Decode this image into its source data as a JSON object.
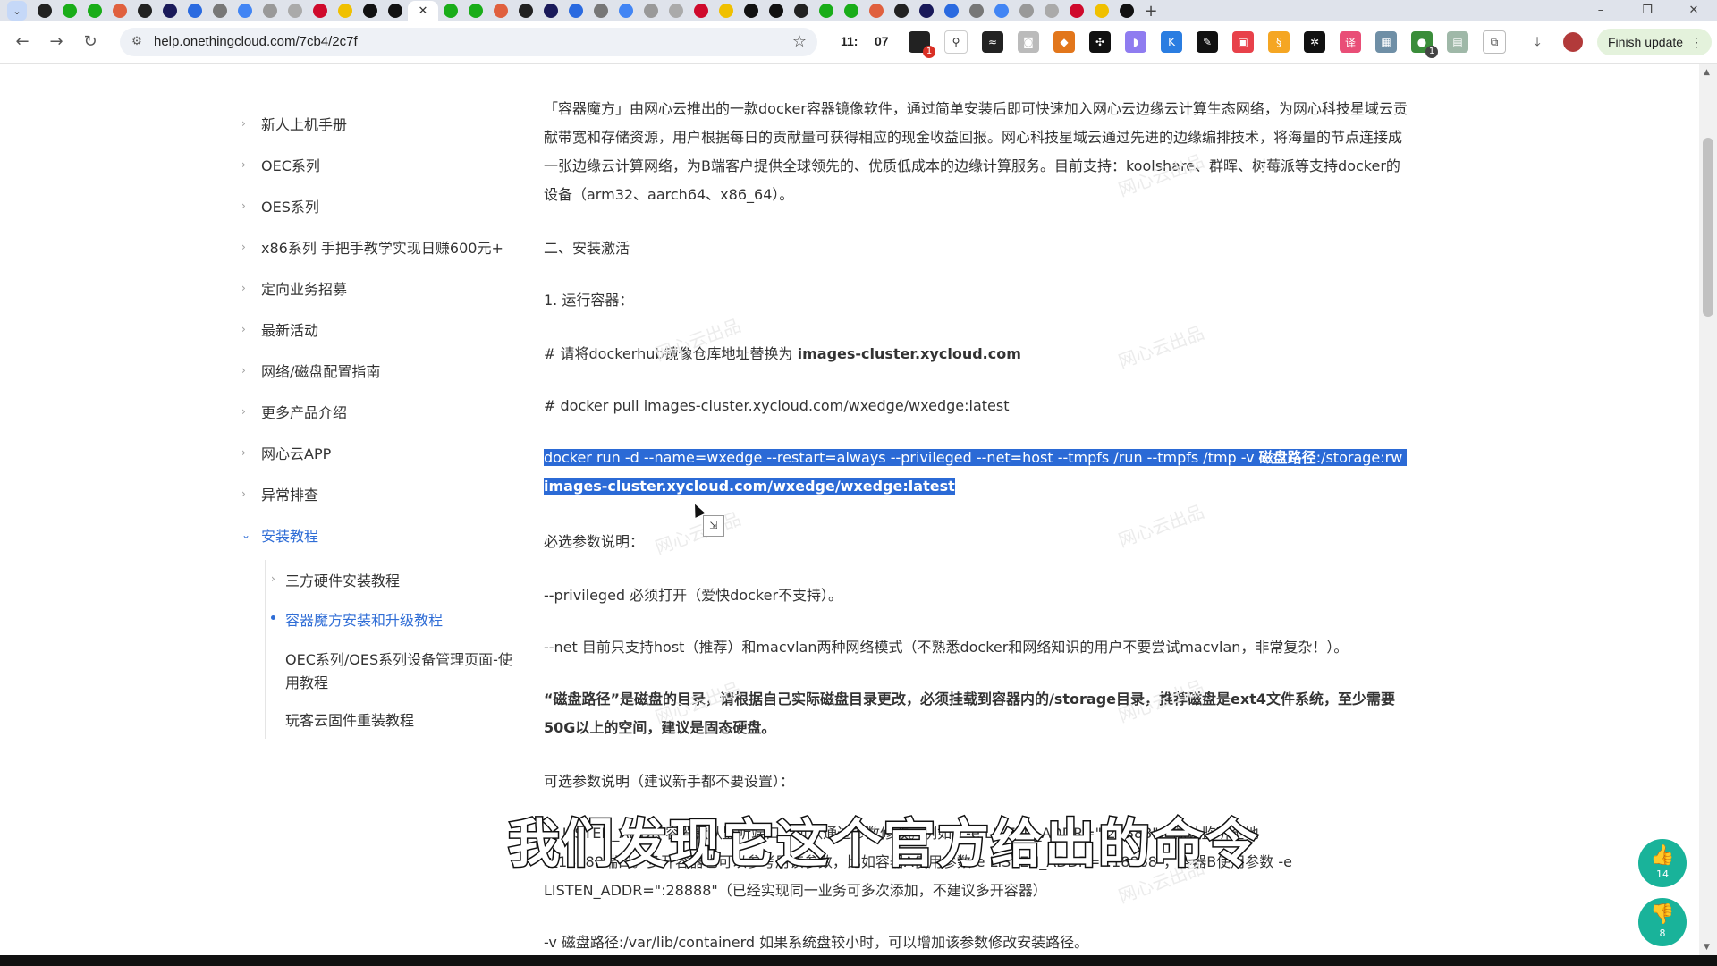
{
  "browser": {
    "tabs_count_visible": 44,
    "url": "help.onethingcloud.com/7cb4/2c7f",
    "clock_hour": "11:",
    "clock_min": "07",
    "ext_badge_1": "1",
    "ext_badge_2": "1",
    "finish_update": "Finish update",
    "new_tab": "+",
    "win_min": "–",
    "win_restore": "❐",
    "win_close": "✕"
  },
  "sidebar": {
    "items": [
      {
        "label": "新人上机手册"
      },
      {
        "label": "OEC系列"
      },
      {
        "label": "OES系列"
      },
      {
        "label": "x86系列 手把手教学实现日赚600元+"
      },
      {
        "label": "定向业务招募"
      },
      {
        "label": "最新活动"
      },
      {
        "label": "网络/磁盘配置指南"
      },
      {
        "label": "更多产品介绍"
      },
      {
        "label": "网心云APP"
      },
      {
        "label": "异常排查"
      },
      {
        "label": "安装教程"
      }
    ],
    "sub_items": [
      {
        "label": "三方硬件安装教程"
      },
      {
        "label": "容器魔方安装和升级教程"
      },
      {
        "label": "OEC系列/OES系列设备管理页面-使"
      },
      {
        "label": "用教程"
      },
      {
        "label": "玩客云固件重装教程"
      }
    ]
  },
  "content": {
    "intro_1": "「容器魔方」由网心云推出的一款docker容器镜像软件，通过简单安装后即可快速加入网心云边缘云计算生态网络，为网心科技星域云贡",
    "intro_2": "献带宽和存储资源，用户根据每日的贡献量可获得相应的现金收益回报。网心科技星域云通过先进的边缘编排技术，将海量的节点连接成",
    "intro_3": "一张边缘云计算网络，为B端客户提供全球领先的、优质低成本的边缘计算服务。目前支持：koolshare、群晖、树莓派等支持docker的",
    "intro_4": "设备（arm32、aarch64、x86_64）。",
    "section2": "二、安装激活",
    "step1": "1. 运行容器：",
    "mirror_prefix": "# 请将dockerhub镜像仓库地址替换为 ",
    "mirror_host": "images-cluster.xycloud.com",
    "pull_cmd": "# docker pull  images-cluster.xycloud.com/wxedge/wxedge:latest",
    "run_cmd_a": "docker run -d --name=wxedge --restart=always --privileged --net=host --tmpfs /run --tmpfs /tmp -v ",
    "run_cmd_b": "磁盘路径",
    "run_cmd_c": ":/storage:rw",
    "run_cmd_line2": "images-cluster.xycloud.com/wxedge/wxedge:latest",
    "required_title": "必选参数说明：",
    "privileged_note": "--privileged 必须打开（爱快docker不支持）。",
    "net_note": "--net 目前只支持host（推荐）和macvlan两种网络模式（不熟悉docker和网络知识的用户不要尝试macvlan，非常复杂！）。",
    "disk_note_1": "“磁盘路径”是磁盘的目录，请根据自己实际磁盘目录更改，必须挂载到容器内的/storage目录，推荐磁盘是ext4文件系统，至少需要",
    "disk_note_2": "50G以上的空间，建议是固态硬盘。",
    "optional_title": "可选参数说明（建议新手都不要设置）：",
    "optional_1": "-e LISTEN_ADDR 容器默认监听端口，可以通过参数修改。例如：-e LISTEN_ADDR=\":28888\"，默认监听全地",
    "optional_2": "址18888端口。多开容器也可以参考用该参数，比如容器A使用参数-e LISTEN_ADDR=\":18888\"，容器B使用参数 -e",
    "optional_3": "LISTEN_ADDR=\":28888\"（已经实现同一业务可多次添加，不建议多开容器）",
    "containerd_note": "-v 磁盘路径:/var/lib/containerd 如果系统盘较小时，可以增加该参数修改安装路径。",
    "watermark": "网心云出品"
  },
  "vote": {
    "up_count": "14",
    "down_count": "8"
  },
  "subtitle": "我们发现它这个官方给出的命令",
  "colors": {
    "accent": "#2f6dd6",
    "selection": "#2b6ad6",
    "vote": "#19b39a",
    "finish_bg": "#e4f2dc"
  }
}
